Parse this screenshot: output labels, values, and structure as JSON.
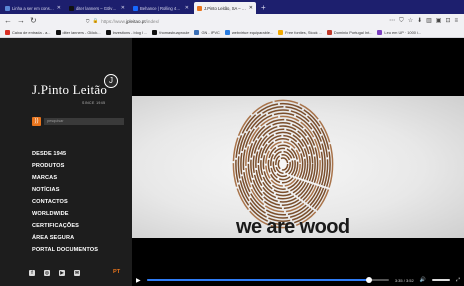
{
  "browser": {
    "tabs": [
      {
        "label": "Linha a ser em consideração por",
        "color": "#5a86d6",
        "active": false
      },
      {
        "label": "diter lanners – Gölvanige F",
        "color": "#111111",
        "active": false
      },
      {
        "label": "Behance | Rolling 4PL | 2018",
        "color": "#1769ff",
        "active": false
      },
      {
        "label": "J.Pinto Leitão, SA – Comércio e",
        "color": "#e8741c",
        "active": true
      }
    ],
    "new_tab": "+",
    "nav": {
      "back": "←",
      "forward": "→",
      "reload": "↻"
    },
    "url": {
      "prefix": "https://www.",
      "domain": "jpleitao.pt",
      "path": "/index/"
    },
    "toolbar_icons": [
      "⋯",
      "⛉",
      "☆",
      "⬇",
      "▥",
      "▣",
      "⊡",
      "≡"
    ],
    "bookmarks": [
      {
        "label": "Caixa de entrada - a...",
        "color": "#d93025"
      },
      {
        "label": "diter lanners - Glöck...",
        "color": "#111111"
      },
      {
        "label": "Investions - blog I ...",
        "color": "#111111"
      },
      {
        "label": "thomasbuaproule",
        "color": "#111111"
      },
      {
        "label": "GN - IPVC",
        "color": "#3b6fb6"
      },
      {
        "label": "webvirtue equiparable...",
        "color": "#2a7de1"
      },
      {
        "label": "Free fonties, Stock ...",
        "color": "#f2a900"
      },
      {
        "label": "Dominio Portugal Int...",
        "color": "#c0392b"
      },
      {
        "label": "Leu em UP · 1000 i...",
        "color": "#7b3fbf"
      }
    ]
  },
  "site": {
    "logo": "J.Pinto Leitão",
    "logo_badge": "J",
    "since": "SINCE 1945",
    "rss": "))",
    "search_placeholder": "pesquisar",
    "menu": [
      "DESDE 1945",
      "PRODUTOS",
      "MARCAS",
      "NOTÍCIAS",
      "CONTACTOS",
      "WORLDWIDE",
      "CERTIFICAÇÕES",
      "ÁREA SEGURA",
      "PORTAL DOCUMENTOS"
    ],
    "social": [
      {
        "name": "facebook",
        "glyph": "f"
      },
      {
        "name": "instagram",
        "glyph": "◎"
      },
      {
        "name": "youtube",
        "glyph": "▶"
      },
      {
        "name": "email",
        "glyph": "✉"
      }
    ],
    "lang": "PT"
  },
  "video": {
    "headline": "we are wood",
    "time": "3:35 / 3:52",
    "progress": 0.92,
    "colors": {
      "accent": "#2f7cf6",
      "brand": "#e8741c"
    }
  }
}
